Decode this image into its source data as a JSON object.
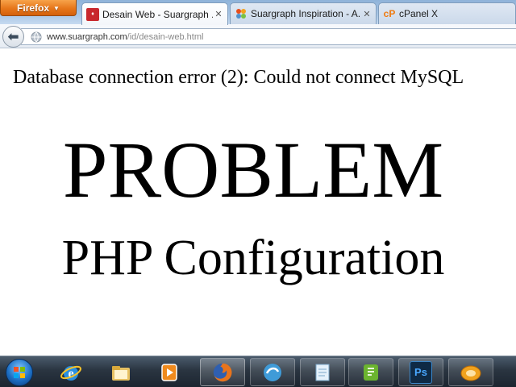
{
  "browser": {
    "menu_button_label": "Firefox",
    "tabs": [
      {
        "title": "Desain Web - Suargraph ...",
        "favicon": "suargraph-favicon",
        "active": true
      },
      {
        "title": "Suargraph Inspiration - A...",
        "favicon": "joomla-favicon",
        "active": false
      },
      {
        "title": "cPanel X",
        "favicon": "cpanel-favicon",
        "active": false
      }
    ],
    "tab_close_glyph": "✕",
    "address": {
      "host": "www.suargraph.com",
      "path": "/id/desain-web.html"
    }
  },
  "page": {
    "error_message": "Database connection error (2): Could not connect MySQL",
    "headline": "PROBLEM",
    "subheadline": "PHP Configuration"
  },
  "taskbar": {
    "items": [
      {
        "name": "start-button",
        "icon": "windows-logo-icon"
      },
      {
        "name": "internet-explorer",
        "icon": "internet-explorer-icon"
      },
      {
        "name": "windows-explorer",
        "icon": "folder-icon"
      },
      {
        "name": "media-player",
        "icon": "media-player-icon"
      },
      {
        "name": "firefox",
        "icon": "firefox-icon",
        "running": true
      },
      {
        "name": "messenger",
        "icon": "messenger-icon"
      },
      {
        "name": "notepad",
        "icon": "notepad-icon"
      },
      {
        "name": "evernote",
        "icon": "evernote-icon"
      },
      {
        "name": "photoshop",
        "icon": "photoshop-icon",
        "label": "Ps"
      },
      {
        "name": "dreamweaver",
        "icon": "app-icon"
      }
    ]
  },
  "colors": {
    "firefox_orange": "#e6761a",
    "tab_bar_blue": "#a9c6e5",
    "taskbar_dark": "#2a3541",
    "cpanel_orange": "#ef7a10"
  }
}
